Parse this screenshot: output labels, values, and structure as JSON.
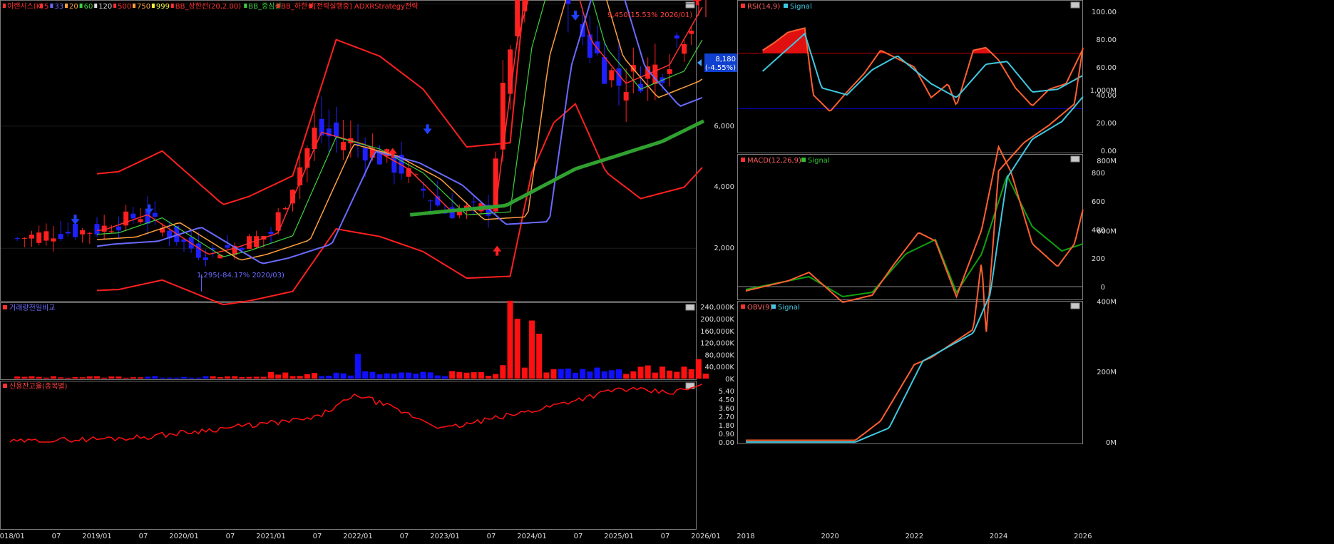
{
  "main": {
    "legend": [
      "이랜시스(K)",
      "5",
      "33",
      "20",
      "60",
      "120",
      "500",
      "750",
      "999",
      "BB_상한선(20,2.00)",
      "BB_중심선",
      "BB_하한선",
      "[전략실행중] ADXRStrategy전략"
    ],
    "legend_colors": [
      "#ff3030",
      "#ff3030",
      "#6a6aff",
      "#ffa040",
      "#40d040",
      "#dddddd",
      "#ff3030",
      "#ffa040",
      "#ffff40",
      "#ff3030",
      "#40d040",
      "#ff3030",
      "#ff3030"
    ],
    "high_label": "9,450(15.53% 2026/01)",
    "low_label": "1,295(-84.17% 2020/03)",
    "price_tag": "8,180",
    "price_change": "(-4.55%)",
    "y_ticks": [
      "6,000",
      "4,000",
      "2,000"
    ]
  },
  "volume": {
    "title": "거래량전일비교",
    "y_ticks": [
      "240,000K",
      "200,000K",
      "160,000K",
      "120,000K",
      "80,000K",
      "40,000K",
      "0K"
    ]
  },
  "credit": {
    "title": "신용잔고율(종목별)",
    "y_ticks": [
      "5.40",
      "4.50",
      "3.60",
      "2.70",
      "1.80",
      "0.90",
      "0.00"
    ]
  },
  "x_axis_left": [
    "2018/01",
    "07",
    "2019/01",
    "07",
    "2020/01",
    "07",
    "2021/01",
    "07",
    "2022/01",
    "07",
    "2023/01",
    "07",
    "2024/01",
    "07",
    "2025/01",
    "07",
    "2026/01"
  ],
  "rsi": {
    "title": "RSI(14,9)",
    "signal": "Signal",
    "y_ticks": [
      "100.00",
      "80.00",
      "60.00",
      "40.00",
      "20.00",
      "0.00"
    ]
  },
  "macd": {
    "title": "MACD(12,26,9)",
    "signal": "Signal",
    "y_ticks": [
      "800",
      "600",
      "400",
      "200",
      "0"
    ]
  },
  "obv": {
    "title": "OBV(9)",
    "signal": "Signal",
    "y_ticks": [
      "1,000M",
      "800M",
      "600M",
      "400M",
      "200M",
      "0M"
    ]
  },
  "x_axis_right": [
    "2018",
    "2020",
    "2022",
    "2024",
    "2026"
  ],
  "chart_data": [
    {
      "type": "candlestick",
      "title": "이랜시스(K)",
      "period": "monthly",
      "ylim": [
        900,
        10300
      ],
      "approx_close": [
        [
          2018.0,
          2150
        ],
        [
          2018.5,
          2250
        ],
        [
          2019.0,
          2300
        ],
        [
          2019.5,
          2550
        ],
        [
          2020.2,
          1900
        ],
        [
          2020.5,
          2000
        ],
        [
          2021.0,
          2250
        ],
        [
          2021.5,
          3900
        ],
        [
          2022.0,
          3700
        ],
        [
          2022.5,
          3300
        ],
        [
          2023.0,
          2600
        ],
        [
          2023.5,
          2650
        ],
        [
          2023.75,
          5400
        ],
        [
          2024.0,
          6700
        ],
        [
          2024.25,
          7200
        ],
        [
          2024.6,
          5400
        ],
        [
          2025.0,
          4700
        ],
        [
          2025.5,
          5000
        ],
        [
          2025.9,
          6000
        ],
        [
          2026.0,
          8180
        ]
      ],
      "high": 9450,
      "low": 1295
    },
    {
      "type": "bar",
      "title": "거래량전일비교",
      "approx_peaks_K": [
        [
          2021.0,
          22000
        ],
        [
          2022.0,
          82000
        ],
        [
          2023.75,
          260000
        ],
        [
          2023.85,
          200000
        ],
        [
          2024.0,
          194000
        ],
        [
          2024.1,
          150000
        ],
        [
          2025.95,
          65000
        ]
      ]
    },
    {
      "type": "line",
      "title": "신용잔고율(종목별)",
      "approx": [
        [
          2018.0,
          0.0
        ],
        [
          2019.5,
          0.5
        ],
        [
          2020.5,
          1.5
        ],
        [
          2021.5,
          2.5
        ],
        [
          2022.0,
          5.0
        ],
        [
          2023.0,
          1.4
        ],
        [
          2024.0,
          3.3
        ],
        [
          2025.0,
          5.6
        ],
        [
          2025.6,
          5.2
        ],
        [
          2026.0,
          6.0
        ]
      ]
    },
    {
      "type": "line",
      "title": "RSI(14,9)",
      "ylim": [
        0,
        100
      ],
      "reference_lines": [
        70,
        30
      ],
      "series": [
        {
          "name": "RSI(14,9)",
          "values": [
            [
              2018.4,
              72
            ],
            [
              2018.7,
              78
            ],
            [
              2019.0,
              85
            ],
            [
              2019.4,
              88
            ],
            [
              2019.6,
              40
            ],
            [
              2020.0,
              28
            ],
            [
              2020.4,
              42
            ],
            [
              2020.8,
              55
            ],
            [
              2021.2,
              72
            ],
            [
              2021.6,
              66
            ],
            [
              2022.0,
              60
            ],
            [
              2022.4,
              38
            ],
            [
              2022.8,
              48
            ],
            [
              2023.0,
              32
            ],
            [
              2023.4,
              72
            ],
            [
              2023.7,
              74
            ],
            [
              2024.0,
              65
            ],
            [
              2024.4,
              45
            ],
            [
              2024.8,
              32
            ],
            [
              2025.2,
              44
            ],
            [
              2025.6,
              48
            ],
            [
              2026.0,
              73
            ]
          ]
        },
        {
          "name": "Signal",
          "values": [
            [
              2018.4,
              57
            ],
            [
              2019.4,
              84
            ],
            [
              2019.8,
              45
            ],
            [
              2020.4,
              40
            ],
            [
              2021.0,
              58
            ],
            [
              2021.6,
              68
            ],
            [
              2022.4,
              48
            ],
            [
              2023.0,
              38
            ],
            [
              2023.7,
              62
            ],
            [
              2024.2,
              64
            ],
            [
              2024.8,
              42
            ],
            [
              2025.4,
              44
            ],
            [
              2026.0,
              54
            ]
          ]
        }
      ]
    },
    {
      "type": "line",
      "title": "MACD(12,26,9)",
      "ylim": [
        -110,
        1000
      ],
      "reference_lines": [
        0
      ],
      "series": [
        {
          "name": "MACD(12,26,9)",
          "values": [
            [
              2018.0,
              -30
            ],
            [
              2019.0,
              40
            ],
            [
              2019.5,
              100
            ],
            [
              2020.3,
              -110
            ],
            [
              2021.0,
              -60
            ],
            [
              2021.5,
              150
            ],
            [
              2022.1,
              380
            ],
            [
              2022.5,
              320
            ],
            [
              2023.0,
              -70
            ],
            [
              2023.6,
              400
            ],
            [
              2024.0,
              980
            ],
            [
              2024.3,
              800
            ],
            [
              2024.8,
              300
            ],
            [
              2025.4,
              140
            ],
            [
              2025.8,
              300
            ],
            [
              2026.0,
              540
            ]
          ]
        },
        {
          "name": "Signal",
          "values": [
            [
              2018.0,
              -20
            ],
            [
              2019.5,
              70
            ],
            [
              2020.3,
              -70
            ],
            [
              2021.0,
              -40
            ],
            [
              2021.8,
              230
            ],
            [
              2022.5,
              330
            ],
            [
              2023.0,
              -40
            ],
            [
              2023.6,
              230
            ],
            [
              2024.2,
              780
            ],
            [
              2024.8,
              420
            ],
            [
              2025.5,
              250
            ],
            [
              2026.0,
              300
            ]
          ]
        }
      ]
    },
    {
      "type": "line",
      "title": "OBV(9)",
      "ylim": [
        0,
        1100
      ],
      "series": [
        {
          "name": "OBV(9)",
          "values": [
            [
              2018.0,
              5
            ],
            [
              2020.6,
              5
            ],
            [
              2021.2,
              60
            ],
            [
              2022.0,
              220
            ],
            [
              2022.4,
              240
            ],
            [
              2023.4,
              320
            ],
            [
              2023.6,
              520
            ],
            [
              2023.7,
              300
            ],
            [
              2024.0,
              770
            ],
            [
              2024.6,
              850
            ],
            [
              2025.2,
              900
            ],
            [
              2025.8,
              960
            ],
            [
              2026.0,
              1120
            ]
          ]
        },
        {
          "name": "Signal",
          "values": [
            [
              2018.0,
              0
            ],
            [
              2020.6,
              0
            ],
            [
              2021.4,
              40
            ],
            [
              2022.2,
              230
            ],
            [
              2023.4,
              310
            ],
            [
              2023.8,
              420
            ],
            [
              2024.2,
              750
            ],
            [
              2024.8,
              860
            ],
            [
              2025.5,
              910
            ],
            [
              2026.0,
              980
            ]
          ]
        }
      ]
    }
  ]
}
